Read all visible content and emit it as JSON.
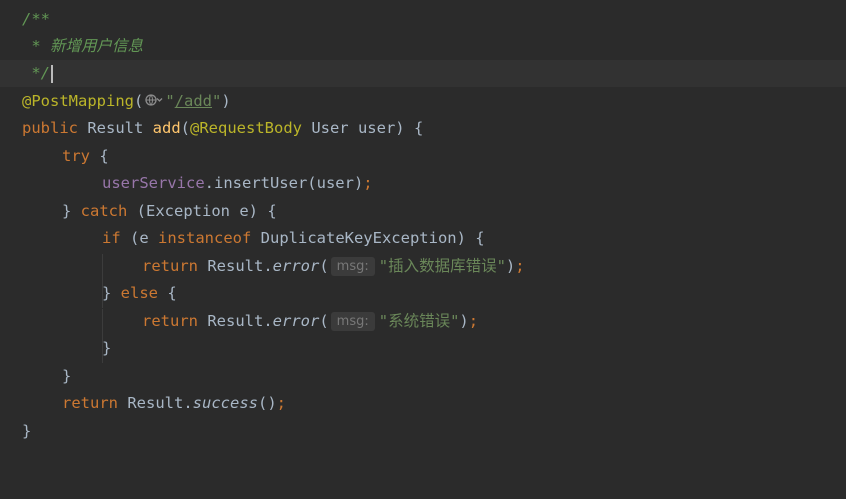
{
  "editor": {
    "lines": [
      {
        "a": "/**"
      },
      {
        "a": " * 新增用户信息"
      },
      {
        "a": " */"
      },
      {
        "anno": "@PostMapping",
        "paren_open": "(",
        "url_q1": "\"",
        "url": "/add",
        "url_q2": "\"",
        "paren_close": ")"
      },
      {
        "kw": "public",
        "type": " Result ",
        "fn": "add",
        "p1": "(",
        "anno": "@RequestBody",
        "rest": " User user) {"
      },
      {
        "kw": "try",
        "rest": " {"
      },
      {
        "field": "userService",
        "rest": ".insertUser(user)",
        "semi": ";"
      },
      {
        "pre": "} ",
        "kw": "catch",
        "rest": " (Exception e) {"
      },
      {
        "kw": "if",
        "pre": " (e ",
        "kw2": "instanceof",
        "rest": " DuplicateKeyException) {"
      },
      {
        "kw": "return",
        "pre": " Result.",
        "static": "error",
        "p1": "(",
        "hint": "msg:",
        "str": "\"插入数据库错误\"",
        "p2": ")",
        "semi": ";"
      },
      {
        "pre": "} ",
        "kw": "else",
        "rest": " {"
      },
      {
        "kw": "return",
        "pre": " Result.",
        "static": "error",
        "p1": "(",
        "hint": "msg:",
        "str": "\"系统错误\"",
        "p2": ")",
        "semi": ";"
      },
      {
        "a": "}"
      },
      {
        "a": "}"
      },
      {
        "kw": "return",
        "pre": " Result.",
        "static": "success",
        "p1": "()",
        "semi": ";"
      },
      {
        "a": "}"
      }
    ]
  },
  "icons": {
    "mapping_gutter": "globe-dropdown-icon"
  }
}
